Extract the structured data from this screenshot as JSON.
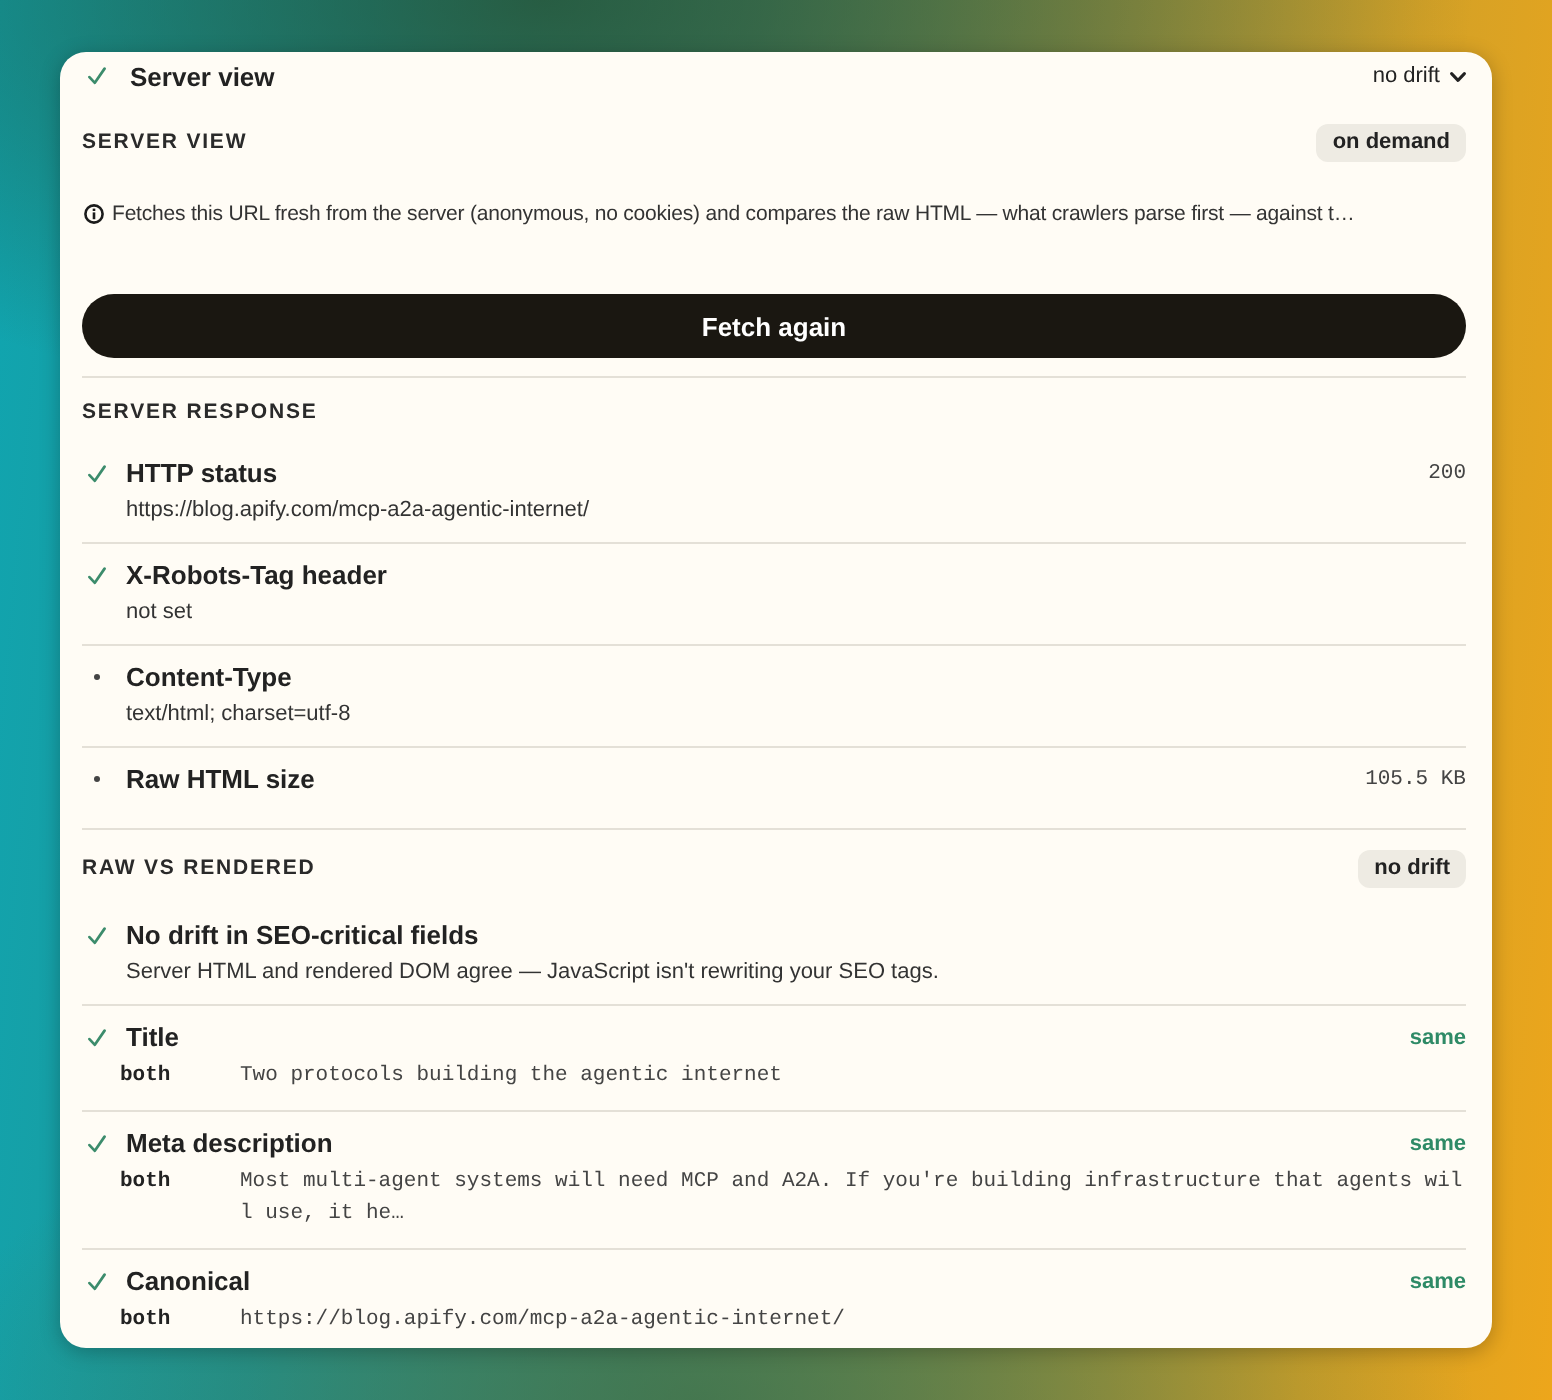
{
  "panel": {
    "title": "Server view",
    "passed": true,
    "summary": "no drift",
    "expanded": true
  },
  "server_view": {
    "heading": "SERVER VIEW",
    "badge": "on demand",
    "info": "Fetches this URL fresh from the server (anonymous, no cookies) and compares the raw HTML — what crawlers parse first — against t…",
    "button": "Fetch again"
  },
  "server_response": {
    "heading": "SERVER RESPONSE",
    "rows": [
      {
        "passed": true,
        "label": "HTTP status",
        "detail": "https://blog.apify.com/mcp-a2a-agentic-internet/",
        "value": "200"
      },
      {
        "passed": true,
        "label": "X-Robots-Tag header",
        "detail": "not set"
      },
      {
        "passed": false,
        "label": "Content-Type",
        "detail": "text/html; charset=utf-8"
      },
      {
        "passed": false,
        "label": "Raw HTML size",
        "value": "105.5 KB"
      }
    ]
  },
  "raw_vs_rendered": {
    "heading": "RAW VS RENDERED",
    "badge": "no drift",
    "summary": {
      "passed": true,
      "label": "No drift in SEO-critical fields",
      "detail": "Server HTML and rendered DOM agree — JavaScript isn't rewriting your SEO tags."
    },
    "fields": [
      {
        "passed": true,
        "label": "Title",
        "result": "same",
        "source": "both",
        "value": "Two protocols building the agentic internet"
      },
      {
        "passed": true,
        "label": "Meta description",
        "result": "same",
        "source": "both",
        "value": "Most multi-agent systems will need MCP and A2A. If you're building infrastructure that agents will use, it he…"
      },
      {
        "passed": true,
        "label": "Canonical",
        "result": "same",
        "source": "both",
        "value": "https://blog.apify.com/mcp-a2a-agentic-internet/"
      }
    ]
  }
}
